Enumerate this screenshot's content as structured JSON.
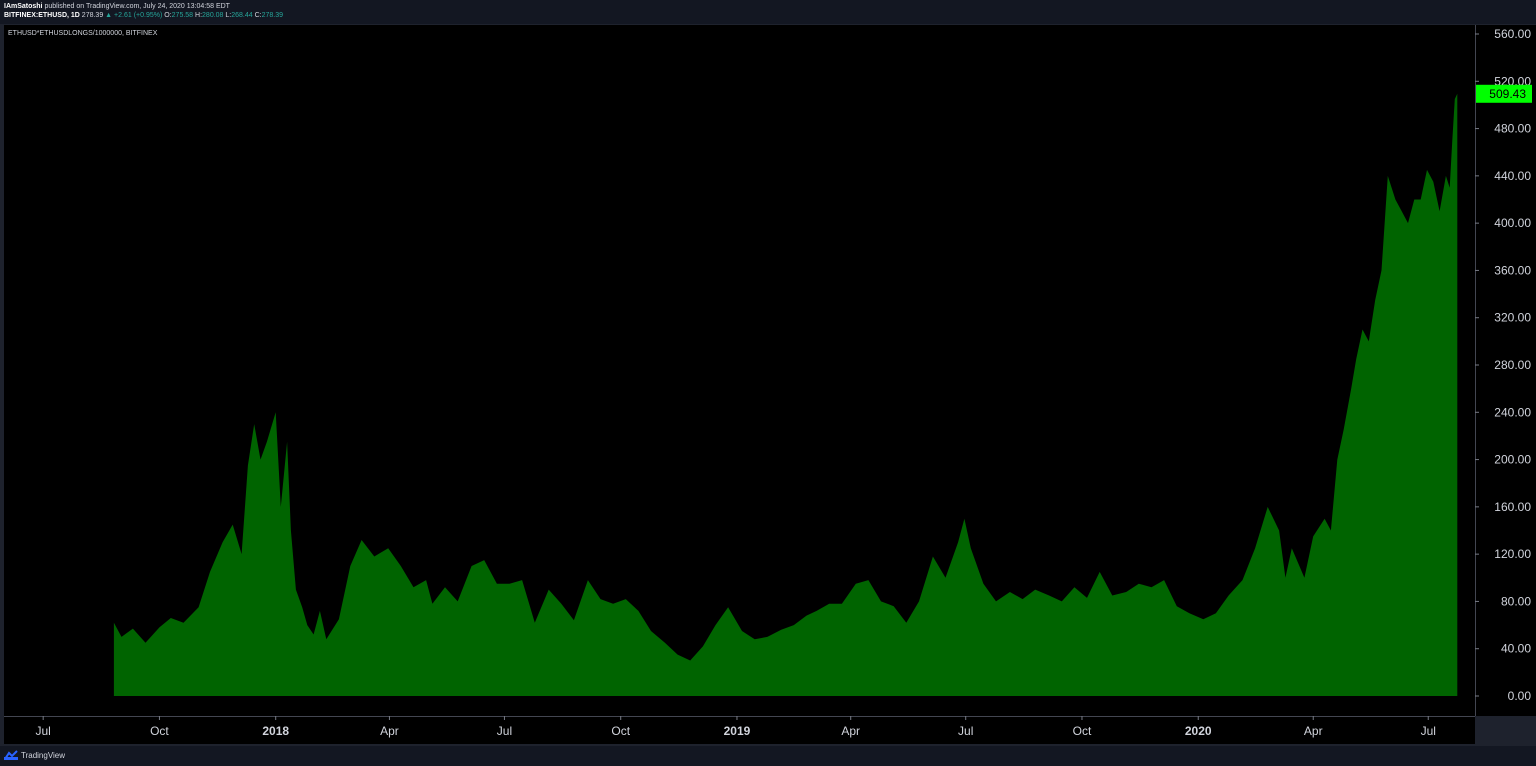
{
  "header": {
    "author": "IAmSatoshi",
    "published": "published on TradingView.com, July 24, 2020 13:04:58 EDT",
    "symbol": "BITFINEX:ETHUSD, 1D",
    "last": "278.39",
    "change": "▲ +2.61 (+0.95%)",
    "o_label": "O:",
    "o_value": "275.58",
    "h_label": "H:",
    "h_value": "280.08",
    "l_label": "L:",
    "l_value": "268.44",
    "c_label": "C:",
    "c_value": "278.39"
  },
  "series_label": "ETHUSD*ETHUSDLONGS/1000000, BITFINEX",
  "footer": {
    "brand": "TradingView",
    "logo_icon": "tradingview-logo-icon"
  },
  "colors": {
    "fill": "#006400",
    "last_badge": "#00ff00",
    "background": "#000000",
    "axis_text": "#d1d4dc"
  },
  "chart_data": {
    "type": "area",
    "last_value_label": "509.43",
    "ylim": [
      0,
      560
    ],
    "y_ticks": [
      "560.00",
      "520.00",
      "480.00",
      "440.00",
      "400.00",
      "360.00",
      "320.00",
      "280.00",
      "240.00",
      "200.00",
      "160.00",
      "120.00",
      "80.00",
      "40.00",
      "0.00"
    ],
    "y_tick_values": [
      560,
      520,
      480,
      440,
      400,
      360,
      320,
      280,
      240,
      200,
      160,
      120,
      80,
      40,
      0
    ],
    "x_ticks": [
      {
        "label": "Jul",
        "date": "2017-07-01",
        "bold": false
      },
      {
        "label": "Oct",
        "date": "2017-10-01",
        "bold": false
      },
      {
        "label": "2018",
        "date": "2018-01-01",
        "bold": true
      },
      {
        "label": "Apr",
        "date": "2018-04-01",
        "bold": false
      },
      {
        "label": "Jul",
        "date": "2018-07-01",
        "bold": false
      },
      {
        "label": "Oct",
        "date": "2018-10-01",
        "bold": false
      },
      {
        "label": "2019",
        "date": "2019-01-01",
        "bold": true
      },
      {
        "label": "Apr",
        "date": "2019-04-01",
        "bold": false
      },
      {
        "label": "Jul",
        "date": "2019-07-01",
        "bold": false
      },
      {
        "label": "Oct",
        "date": "2019-10-01",
        "bold": false
      },
      {
        "label": "2020",
        "date": "2020-01-01",
        "bold": true
      },
      {
        "label": "Apr",
        "date": "2020-04-01",
        "bold": false
      },
      {
        "label": "Jul",
        "date": "2020-07-01",
        "bold": false
      }
    ],
    "x_range": [
      "2017-05-31",
      "2020-08-07"
    ],
    "series": [
      {
        "x": [
          "2017-08-26",
          "2017-09-01",
          "2017-09-10",
          "2017-09-20",
          "2017-10-01",
          "2017-10-10",
          "2017-10-20",
          "2017-11-01",
          "2017-11-10",
          "2017-11-20",
          "2017-11-28",
          "2017-12-05",
          "2017-12-10",
          "2017-12-15",
          "2017-12-20",
          "2017-12-25",
          "2018-01-01",
          "2018-01-05",
          "2018-01-10",
          "2018-01-13",
          "2018-01-17",
          "2018-01-22",
          "2018-01-26",
          "2018-01-31",
          "2018-02-05",
          "2018-02-10",
          "2018-02-20",
          "2018-03-01",
          "2018-03-10",
          "2018-03-20",
          "2018-03-31",
          "2018-04-10",
          "2018-04-20",
          "2018-04-30",
          "2018-05-05",
          "2018-05-15",
          "2018-05-25",
          "2018-06-05",
          "2018-06-15",
          "2018-06-25",
          "2018-07-05",
          "2018-07-15",
          "2018-07-25",
          "2018-08-05",
          "2018-08-15",
          "2018-08-25",
          "2018-09-05",
          "2018-09-15",
          "2018-09-25",
          "2018-10-05",
          "2018-10-15",
          "2018-10-25",
          "2018-11-05",
          "2018-11-15",
          "2018-11-25",
          "2018-12-05",
          "2018-12-15",
          "2018-12-25",
          "2019-01-05",
          "2019-01-15",
          "2019-01-25",
          "2019-02-05",
          "2019-02-15",
          "2019-02-25",
          "2019-03-05",
          "2019-03-15",
          "2019-03-25",
          "2019-04-05",
          "2019-04-15",
          "2019-04-25",
          "2019-05-05",
          "2019-05-15",
          "2019-05-25",
          "2019-06-05",
          "2019-06-15",
          "2019-06-25",
          "2019-06-30",
          "2019-07-05",
          "2019-07-15",
          "2019-07-25",
          "2019-08-05",
          "2019-08-15",
          "2019-08-25",
          "2019-09-05",
          "2019-09-15",
          "2019-09-25",
          "2019-10-05",
          "2019-10-15",
          "2019-10-25",
          "2019-11-05",
          "2019-11-15",
          "2019-11-25",
          "2019-12-05",
          "2019-12-15",
          "2019-12-25",
          "2020-01-05",
          "2020-01-15",
          "2020-01-25",
          "2020-02-05",
          "2020-02-15",
          "2020-02-25",
          "2020-03-05",
          "2020-03-10",
          "2020-03-15",
          "2020-03-25",
          "2020-04-01",
          "2020-04-10",
          "2020-04-15",
          "2020-04-20",
          "2020-04-25",
          "2020-05-01",
          "2020-05-05",
          "2020-05-10",
          "2020-05-15",
          "2020-05-20",
          "2020-05-25",
          "2020-05-30",
          "2020-06-05",
          "2020-06-10",
          "2020-06-15",
          "2020-06-20",
          "2020-06-25",
          "2020-06-30",
          "2020-07-05",
          "2020-07-10",
          "2020-07-15",
          "2020-07-18",
          "2020-07-20",
          "2020-07-22",
          "2020-07-24"
        ],
        "values": [
          62,
          50,
          57,
          45,
          58,
          66,
          62,
          75,
          105,
          130,
          145,
          120,
          195,
          230,
          200,
          215,
          240,
          160,
          215,
          140,
          90,
          75,
          60,
          52,
          72,
          48,
          65,
          110,
          132,
          118,
          125,
          110,
          92,
          98,
          78,
          92,
          80,
          110,
          115,
          95,
          95,
          98,
          62,
          90,
          78,
          64,
          98,
          82,
          78,
          82,
          72,
          55,
          45,
          35,
          30,
          42,
          60,
          75,
          55,
          48,
          50,
          56,
          60,
          68,
          72,
          78,
          78,
          95,
          98,
          80,
          76,
          62,
          80,
          118,
          100,
          130,
          150,
          125,
          95,
          80,
          88,
          82,
          90,
          85,
          80,
          92,
          83,
          105,
          85,
          88,
          95,
          92,
          98,
          76,
          70,
          65,
          70,
          85,
          98,
          125,
          160,
          140,
          100,
          125,
          100,
          135,
          150,
          140,
          200,
          225,
          260,
          285,
          310,
          300,
          335,
          360,
          440,
          420,
          410,
          400,
          420,
          420,
          445,
          435,
          410,
          440,
          430,
          470,
          505,
          509.43
        ]
      }
    ]
  }
}
